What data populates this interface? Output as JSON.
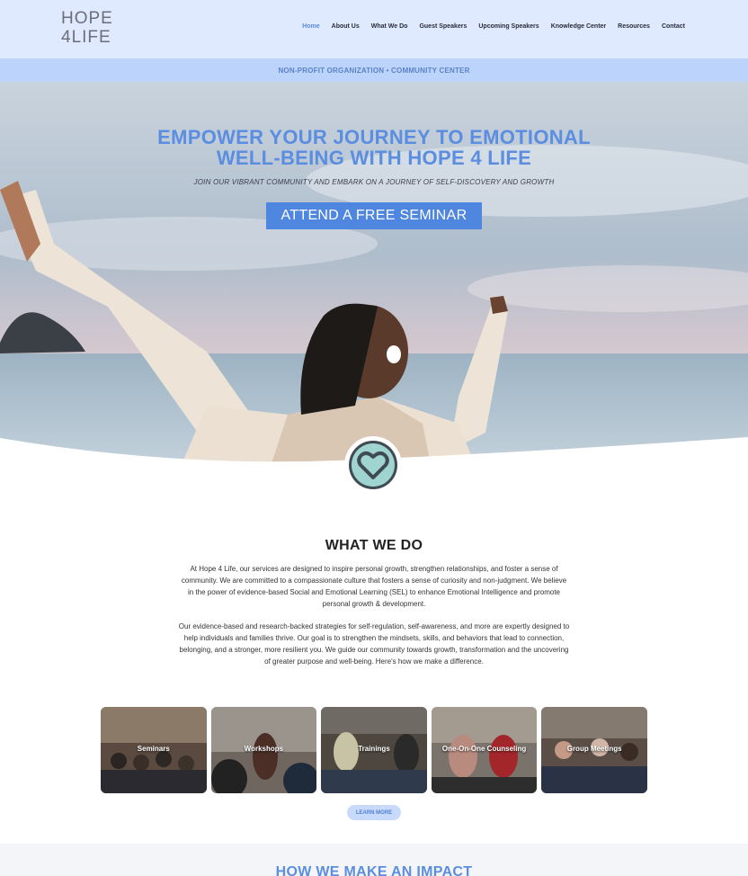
{
  "logo": {
    "line1": "HOPE",
    "line2": "4LIFE"
  },
  "nav": {
    "items": [
      "Home",
      "About Us",
      "What We Do",
      "Guest Speakers",
      "Upcoming Speakers",
      "Knowledge Center",
      "Resources",
      "Contact"
    ],
    "active": "Home"
  },
  "strip": {
    "text": "NON-PROFIT ORGANIZATION • COMMUNITY CENTER"
  },
  "hero": {
    "title_line1": "EMPOWER YOUR JOURNEY TO EMOTIONAL",
    "title_line2": "WELL-BEING WITH HOPE 4 LIFE",
    "subtitle": "JOIN OUR VIBRANT COMMUNITY AND EMBARK ON A JOURNEY OF SELF-DISCOVERY AND GROWTH",
    "cta_label": "ATTEND A FREE SEMINAR"
  },
  "what_we_do": {
    "title": "WHAT WE DO",
    "paragraph1": "At Hope 4 Life, our services are designed to inspire personal growth, strengthen relationships, and foster a sense of community. We are committed to a compassionate culture that fosters a sense of curiosity and non-judgment. We believe in the power of evidence-based Social and Emotional Learning (SEL) to enhance Emotional Intelligence and promote personal growth & development.",
    "paragraph2": "Our evidence-based and research-backed strategies for self-regulation, self-awareness, and more are expertly designed to help individuals and families thrive. Our goal is to strengthen the mindsets, skills, and behaviors that lead to connection, belonging, and a stronger, more resilient you. We guide our community towards growth, transformation and the uncovering of greater purpose and well-being. Here's how we make a difference.",
    "cards": [
      {
        "label": "Seminars"
      },
      {
        "label": "Workshops"
      },
      {
        "label": "Trainings"
      },
      {
        "label": "One-On-One Counseling"
      },
      {
        "label": "Group Meetings"
      }
    ],
    "learn_more": "LEARN MORE"
  },
  "impact": {
    "title": "HOW WE MAKE AN IMPACT"
  },
  "colors": {
    "accent": "#5b8ee0",
    "header_bg": "#dfe9ff",
    "strip_bg": "#bcd3fb",
    "badge_teal": "#9fd4d0"
  }
}
